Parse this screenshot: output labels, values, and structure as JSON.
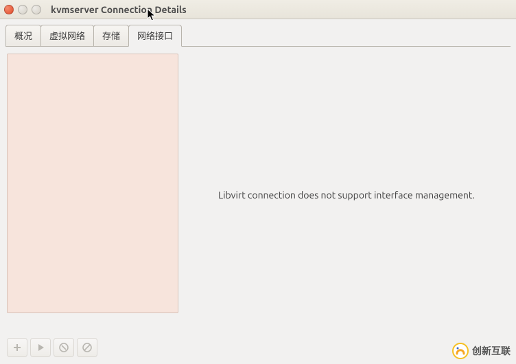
{
  "window": {
    "title": "kvmserver Connection Details"
  },
  "tabs": [
    {
      "label": "概况"
    },
    {
      "label": "虚拟网络"
    },
    {
      "label": "存储"
    },
    {
      "label": "网络接口"
    }
  ],
  "activeTabIndex": 3,
  "main": {
    "message": "Libvirt connection does not support interface management."
  },
  "toolbar": {
    "add_label": "add",
    "play_label": "start",
    "stop_label": "stop",
    "delete_label": "delete"
  },
  "watermark": {
    "text": "创新互联"
  }
}
